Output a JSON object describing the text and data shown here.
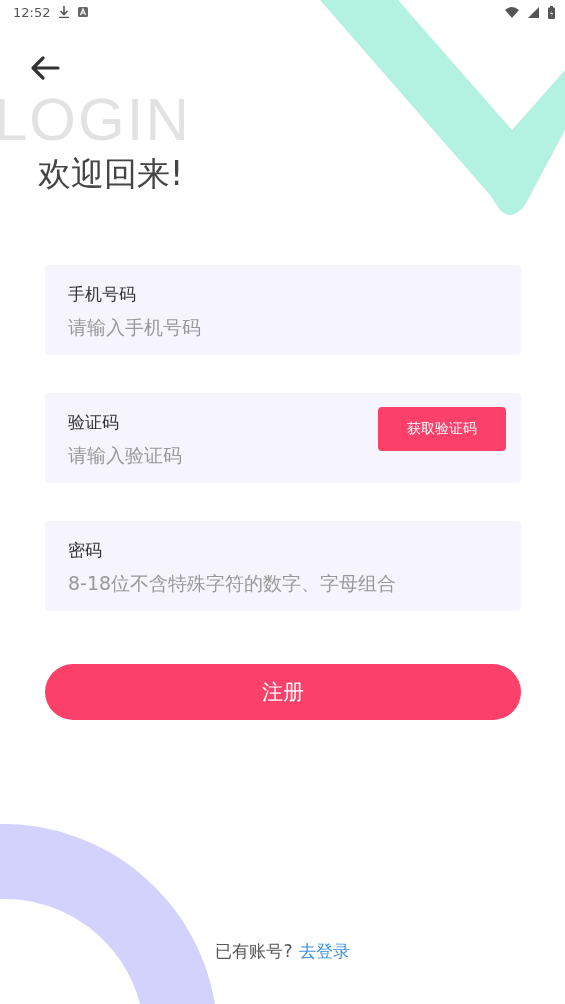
{
  "status_bar": {
    "time": "12:52"
  },
  "background_text": "LOGIN",
  "title": "欢迎回来!",
  "fields": [
    {
      "label": "手机号码",
      "placeholder": "请输入手机号码"
    },
    {
      "label": "验证码",
      "placeholder": "请输入验证码",
      "action": "获取验证码"
    },
    {
      "label": "密码",
      "placeholder": "8-18位不含特殊字符的数字、字母组合"
    }
  ],
  "submit": "注册",
  "footer": {
    "text": "已有账号?",
    "link": "去登录"
  }
}
